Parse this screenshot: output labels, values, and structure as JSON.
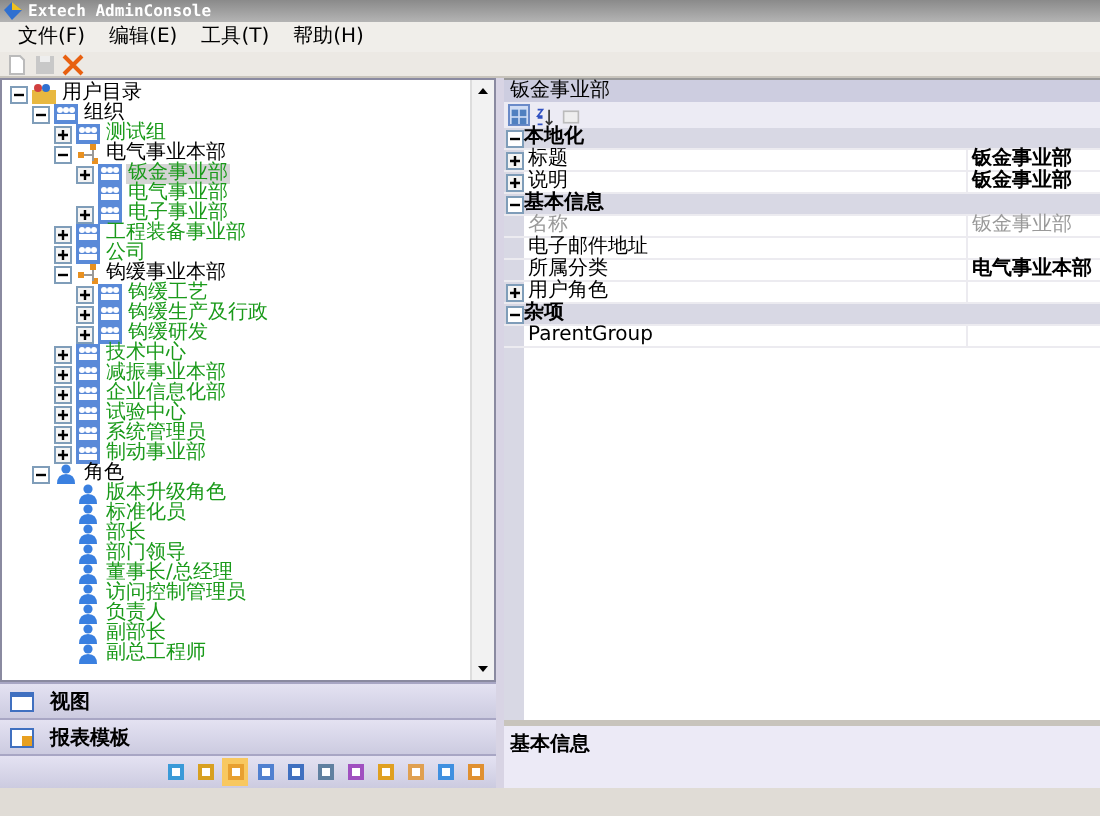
{
  "window": {
    "title": "Extech AdminConsole"
  },
  "menu": [
    "文件(F)",
    "编辑(E)",
    "工具(T)",
    "帮助(H)"
  ],
  "toolbar": [
    {
      "kind": "new",
      "disabled": true
    },
    {
      "kind": "save",
      "disabled": true
    },
    {
      "kind": "delete",
      "disabled": false
    }
  ],
  "tree": [
    {
      "label": "用户目录",
      "kind": "root",
      "expanded": true,
      "selected": false,
      "children": [
        {
          "label": "组织",
          "kind": "org",
          "expanded": true,
          "selected": false,
          "children": [
            {
              "label": "测试组",
              "kind": "group",
              "expanded": false,
              "selected": false
            },
            {
              "label": "电气事业本部",
              "kind": "division",
              "expanded": true,
              "selected": false,
              "children": [
                {
                  "label": "钣金事业部",
                  "kind": "group",
                  "expanded": false,
                  "selected": true
                },
                {
                  "label": "电气事业部",
                  "kind": "group",
                  "selected": false
                },
                {
                  "label": "电子事业部",
                  "kind": "group",
                  "expanded": false,
                  "selected": false
                }
              ]
            },
            {
              "label": "工程装备事业部",
              "kind": "group",
              "expanded": false,
              "selected": false
            },
            {
              "label": "公司",
              "kind": "group",
              "expanded": false,
              "selected": false
            },
            {
              "label": "钩缓事业本部",
              "kind": "division",
              "expanded": true,
              "selected": false,
              "children": [
                {
                  "label": "钩缓工艺",
                  "kind": "group",
                  "expanded": false,
                  "selected": false
                },
                {
                  "label": "钩缓生产及行政",
                  "kind": "group",
                  "expanded": false,
                  "selected": false
                },
                {
                  "label": "钩缓研发",
                  "kind": "group",
                  "expanded": false,
                  "selected": false
                }
              ]
            },
            {
              "label": "技术中心",
              "kind": "group",
              "expanded": false,
              "selected": false
            },
            {
              "label": "减振事业本部",
              "kind": "group",
              "expanded": false,
              "selected": false
            },
            {
              "label": "企业信息化部",
              "kind": "group",
              "expanded": false,
              "selected": false
            },
            {
              "label": "试验中心",
              "kind": "group",
              "expanded": false,
              "selected": false
            },
            {
              "label": "系统管理员",
              "kind": "group",
              "expanded": false,
              "selected": false
            },
            {
              "label": "制动事业部",
              "kind": "group",
              "expanded": false,
              "selected": false
            }
          ]
        },
        {
          "label": "角色",
          "kind": "rolefolder",
          "expanded": true,
          "selected": false,
          "children": [
            {
              "label": "版本升级角色",
              "kind": "role",
              "selected": false
            },
            {
              "label": "标准化员",
              "kind": "role",
              "selected": false
            },
            {
              "label": "部长",
              "kind": "role",
              "selected": false
            },
            {
              "label": "部门领导",
              "kind": "role",
              "selected": false
            },
            {
              "label": "董事长/总经理",
              "kind": "role",
              "selected": false
            },
            {
              "label": "访问控制管理员",
              "kind": "role",
              "selected": false
            },
            {
              "label": "负责人",
              "kind": "role",
              "selected": false
            },
            {
              "label": "副部长",
              "kind": "role",
              "selected": false
            },
            {
              "label": "副总工程师",
              "kind": "role",
              "selected": false
            }
          ]
        }
      ]
    }
  ],
  "nav_panels": [
    {
      "label": "视图",
      "kind": "view"
    },
    {
      "label": "报表模板",
      "kind": "report"
    }
  ],
  "nav_icons": [
    {
      "selected": false
    },
    {
      "selected": false
    },
    {
      "selected": true
    },
    {
      "selected": false
    },
    {
      "selected": false
    },
    {
      "selected": false
    },
    {
      "selected": false
    },
    {
      "selected": false
    },
    {
      "selected": false
    },
    {
      "selected": false
    },
    {
      "selected": false
    }
  ],
  "properties": {
    "title": "钣金事业部",
    "toolbar": [
      {
        "kind": "categorized",
        "selected": true
      },
      {
        "kind": "alphabetical",
        "selected": false
      },
      {
        "kind": "pages",
        "selected": false
      }
    ],
    "rows": [
      {
        "kind": "category",
        "label": "本地化",
        "expanded": true
      },
      {
        "kind": "property",
        "label": "标题",
        "value": "钣金事业部",
        "expanded": false,
        "readonly": false,
        "modified": true
      },
      {
        "kind": "property",
        "label": "说明",
        "value": "钣金事业部",
        "expanded": false,
        "readonly": false,
        "modified": true
      },
      {
        "kind": "category",
        "label": "基本信息",
        "expanded": true
      },
      {
        "kind": "property",
        "label": "名称",
        "value": "钣金事业部",
        "readonly": true,
        "modified": false
      },
      {
        "kind": "property",
        "label": "电子邮件地址",
        "readonly": false
      },
      {
        "kind": "property",
        "label": "所属分类",
        "value": "电气事业本部",
        "readonly": false,
        "modified": true
      },
      {
        "kind": "property",
        "label": "用户角色",
        "expanded": false,
        "readonly": false
      },
      {
        "kind": "category",
        "label": "杂项",
        "expanded": true
      },
      {
        "kind": "property",
        "label": "ParentGroup",
        "readonly": false
      }
    ],
    "description": {
      "title": "基本信息"
    }
  }
}
